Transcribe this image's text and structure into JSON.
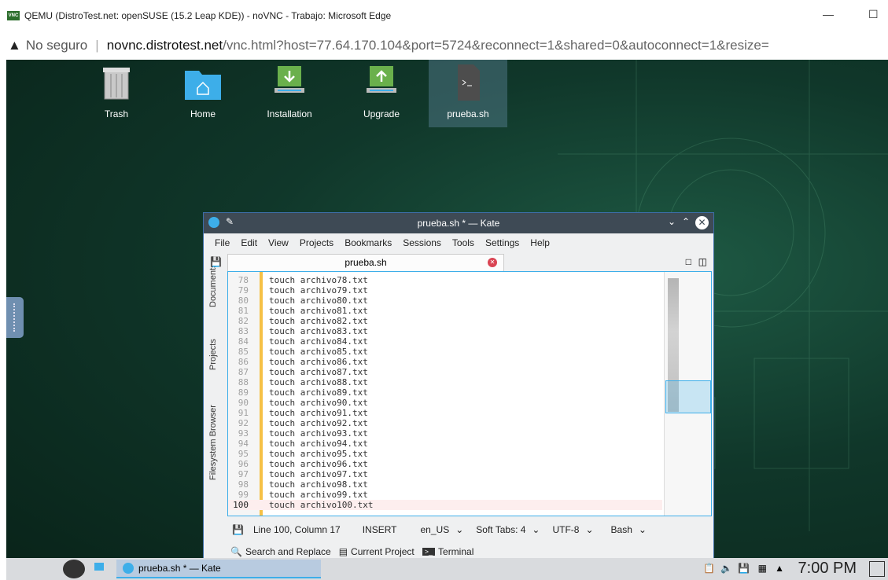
{
  "browser": {
    "window_title": "QEMU (DistroTest.net: openSUSE (15.2 Leap KDE)) - noVNC - Trabajo: Microsoft Edge",
    "minimize": "—",
    "maximize": "☐",
    "security_label": "No seguro",
    "url_host": "novnc.distrotest.net",
    "url_rest": "/vnc.html?host=77.64.170.104&port=5724&reconnect=1&shared=0&autoconnect=1&resize=",
    "vnc_icon_text": "VNC"
  },
  "desktop": {
    "icons": [
      {
        "label": "Trash"
      },
      {
        "label": "Home"
      },
      {
        "label": "Installation"
      },
      {
        "label": "Upgrade"
      },
      {
        "label": "prueba.sh"
      }
    ]
  },
  "kate": {
    "title": "prueba.sh * — Kate",
    "menu": [
      "File",
      "Edit",
      "View",
      "Projects",
      "Bookmarks",
      "Sessions",
      "Tools",
      "Settings",
      "Help"
    ],
    "side_tabs": [
      "Documents",
      "Projects",
      "Filesystem Browser"
    ],
    "tab_label": "prueba.sh",
    "lines": [
      {
        "n": "78",
        "code": "touch archivo78.txt"
      },
      {
        "n": "79",
        "code": "touch archivo79.txt"
      },
      {
        "n": "80",
        "code": "touch archivo80.txt"
      },
      {
        "n": "81",
        "code": "touch archivo81.txt"
      },
      {
        "n": "82",
        "code": "touch archivo82.txt"
      },
      {
        "n": "83",
        "code": "touch archivo83.txt"
      },
      {
        "n": "84",
        "code": "touch archivo84.txt"
      },
      {
        "n": "85",
        "code": "touch archivo85.txt"
      },
      {
        "n": "86",
        "code": "touch archivo86.txt"
      },
      {
        "n": "87",
        "code": "touch archivo87.txt"
      },
      {
        "n": "88",
        "code": "touch archivo88.txt"
      },
      {
        "n": "89",
        "code": "touch archivo89.txt"
      },
      {
        "n": "90",
        "code": "touch archivo90.txt"
      },
      {
        "n": "91",
        "code": "touch archivo91.txt"
      },
      {
        "n": "92",
        "code": "touch archivo92.txt"
      },
      {
        "n": "93",
        "code": "touch archivo93.txt"
      },
      {
        "n": "94",
        "code": "touch archivo94.txt"
      },
      {
        "n": "95",
        "code": "touch archivo95.txt"
      },
      {
        "n": "96",
        "code": "touch archivo96.txt"
      },
      {
        "n": "97",
        "code": "touch archivo97.txt"
      },
      {
        "n": "98",
        "code": "touch archivo98.txt"
      },
      {
        "n": "99",
        "code": "touch archivo99.txt"
      },
      {
        "n": "100",
        "code": "touch archivo100.txt"
      }
    ],
    "status": {
      "position": "Line 100, Column 17",
      "mode": "INSERT",
      "lang": "en_US",
      "indent": "Soft Tabs: 4",
      "encoding": "UTF-8",
      "syntax": "Bash"
    },
    "tools": {
      "search": "Search and Replace",
      "project": "Current Project",
      "terminal": "Terminal"
    }
  },
  "taskbar": {
    "task_label": "prueba.sh * — Kate",
    "clock": "7:00 PM"
  },
  "colors": {
    "accent": "#3daee9",
    "desktop": "#10372a",
    "titlebar": "#3e4a55",
    "modified_bar": "#f6c146"
  }
}
